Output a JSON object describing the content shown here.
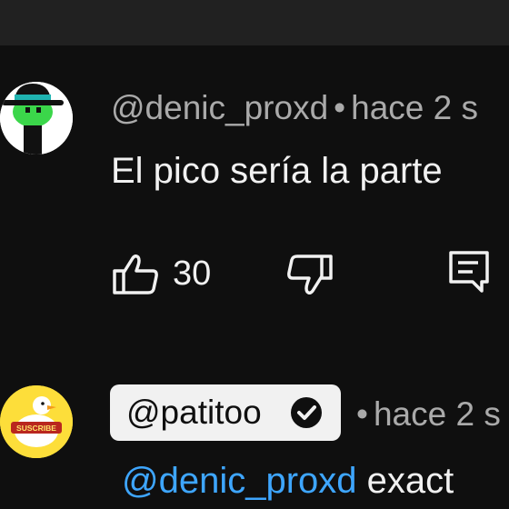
{
  "comments": [
    {
      "username": "@denic_proxd",
      "time_label": "hace 2 s",
      "text": "El pico sería la parte",
      "likes": "30"
    },
    {
      "username": "@patitoo",
      "time_label": "hace 2 s",
      "reply_mention": "@denic_proxd",
      "text": "exact",
      "verified": true
    }
  ],
  "avatar2_label": "SUSCRIBE",
  "separator": "•",
  "colors": {
    "background": "#0f0f0f",
    "mention": "#3ea6ff",
    "meta_text": "#aaaaaa",
    "chip": "#f1f1f1"
  }
}
